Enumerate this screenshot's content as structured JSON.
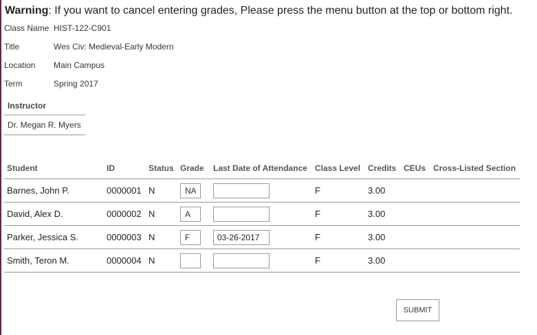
{
  "warning": {
    "label": "Warning",
    "text": ": If you want to cancel entering grades, Please press the menu button at the top or bottom right."
  },
  "class_info": [
    {
      "label": "Class Name",
      "value": "HIST-122-C901"
    },
    {
      "label": "Title",
      "value": "Wes Civ: Medieval-Early Modern"
    },
    {
      "label": "Location",
      "value": "Main Campus"
    },
    {
      "label": "Term",
      "value": "Spring 2017"
    }
  ],
  "instructor": {
    "heading": "Instructor",
    "name": "Dr. Megan R. Myers"
  },
  "table": {
    "headers": {
      "student": "Student",
      "id": "ID",
      "status": "Status",
      "grade": "Grade",
      "last_date": "Last Date of Attendance",
      "class_level": "Class Level",
      "credits": "Credits",
      "ceus": "CEUs",
      "cross_listed": "Cross-Listed Section"
    },
    "rows": [
      {
        "student": "Barnes, John P.",
        "id": "0000001",
        "status": "N",
        "grade": "NA",
        "last_date": "",
        "class_level": "F",
        "credits": "3.00",
        "ceus": "",
        "cross_listed": ""
      },
      {
        "student": "David, Alex D.",
        "id": "0000002",
        "status": "N",
        "grade": "A",
        "last_date": "",
        "class_level": "F",
        "credits": "3.00",
        "ceus": "",
        "cross_listed": ""
      },
      {
        "student": "Parker, Jessica S.",
        "id": "0000003",
        "status": "N",
        "grade": "F",
        "last_date": "03-26-2017",
        "class_level": "F",
        "credits": "3.00",
        "ceus": "",
        "cross_listed": ""
      },
      {
        "student": "Smith, Teron M.",
        "id": "0000004",
        "status": "N",
        "grade": "",
        "last_date": "",
        "class_level": "F",
        "credits": "3.00",
        "ceus": "",
        "cross_listed": ""
      }
    ]
  },
  "submit_label": "SUBMIT",
  "colors": {
    "frame_border": "#5a2a4a",
    "divider": "#999999"
  }
}
